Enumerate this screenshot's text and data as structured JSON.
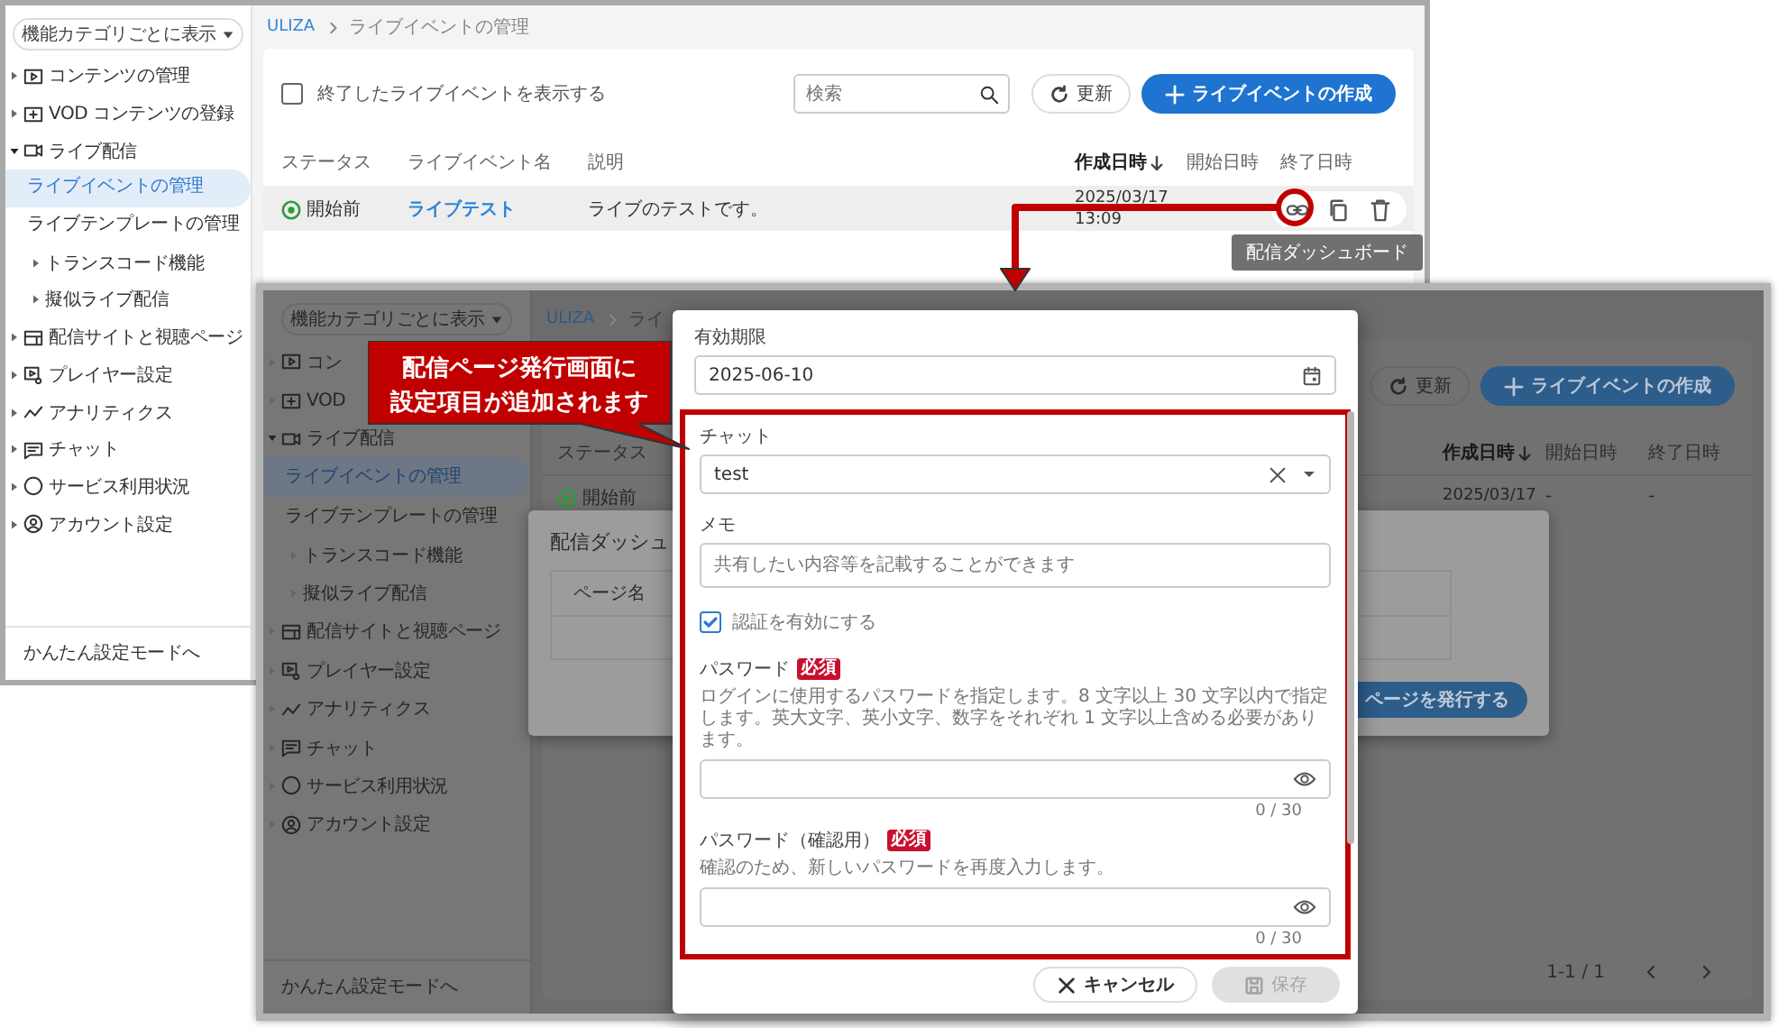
{
  "back_window": {
    "sidebar": {
      "view_selector": "機能カテゴリごとに表示",
      "items": [
        {
          "label": "コンテンツの管理",
          "expanded": false
        },
        {
          "label": "VOD コンテンツの登録",
          "expanded": false
        },
        {
          "label": "ライブ配信",
          "expanded": true,
          "children": [
            {
              "kind": "page",
              "label": "ライブイベントの管理",
              "selected": true
            },
            {
              "kind": "page",
              "label": "ライブテンプレートの管理",
              "selected": false
            },
            {
              "kind": "group",
              "label": "トランスコード機能",
              "expanded": false
            },
            {
              "kind": "group",
              "label": "擬似ライブ配信",
              "expanded": false
            }
          ]
        },
        {
          "label": "配信サイトと視聴ページ",
          "expanded": false
        },
        {
          "label": "プレイヤー設定",
          "expanded": false
        },
        {
          "label": "アナリティクス",
          "expanded": false
        },
        {
          "label": "チャット",
          "expanded": false
        },
        {
          "label": "サービス利用状況",
          "expanded": false
        },
        {
          "label": "アカウント設定",
          "expanded": false
        }
      ],
      "footer": "かんたん設定モードへ"
    },
    "main": {
      "breadcrumb": [
        "ULIZA",
        "ライブイベントの管理"
      ],
      "show_finished": {
        "label": "終了したライブイベントを表示する",
        "checked": false
      },
      "search": {
        "placeholder": "検索"
      },
      "refresh_button": "更新",
      "create_button": "ライブイベントの作成",
      "columns": [
        {
          "label": "ステータス",
          "sorted": false
        },
        {
          "label": "ライブイベント名",
          "sorted": false
        },
        {
          "label": "説明",
          "sorted": false
        },
        {
          "label": "作成日時",
          "sorted": true
        },
        {
          "label": "開始日時",
          "sorted": false
        },
        {
          "label": "終了日時",
          "sorted": false
        }
      ],
      "rows": [
        {
          "status": "開始前",
          "name": "ライブテスト",
          "description": "ライブのテストです。",
          "created": "2025/03/17 13:09"
        }
      ],
      "tooltip": "配信ダッシュボード"
    }
  },
  "front_window": {
    "sidebar": {
      "view_selector": "機能カテゴリごとに表示",
      "items": [
        {
          "label": "コン",
          "expanded": false
        },
        {
          "label": "VOD",
          "expanded": false
        },
        {
          "label": "ライブ配信",
          "expanded": true,
          "children": [
            {
              "kind": "page",
              "label": "ライブイベントの管理",
              "selected": true
            },
            {
              "kind": "page",
              "label": "ライブテンプレートの管理",
              "selected": false
            },
            {
              "kind": "group",
              "label": "トランスコード機能",
              "expanded": false
            },
            {
              "kind": "group",
              "label": "擬似ライブ配信",
              "expanded": false
            }
          ]
        },
        {
          "label": "配信サイトと視聴ページ",
          "expanded": false
        },
        {
          "label": "プレイヤー設定",
          "expanded": false
        },
        {
          "label": "アナリティクス",
          "expanded": false
        },
        {
          "label": "チャット",
          "expanded": false
        },
        {
          "label": "サービス利用状況",
          "expanded": false
        },
        {
          "label": "アカウント設定",
          "expanded": false
        }
      ],
      "footer": "かんたん設定モードへ"
    },
    "main": {
      "breadcrumb": [
        "ULIZA",
        "ライ"
      ],
      "refresh_button": "更新",
      "create_button": "ライブイベントの作成",
      "columns": [
        {
          "label": "ステータス",
          "sorted": false
        },
        {
          "label": "作成日時",
          "sorted": true
        },
        {
          "label": "開始日時",
          "sorted": false
        },
        {
          "label": "終了日時",
          "sorted": false
        }
      ],
      "rows": [
        {
          "status": "開始前",
          "created": "2025/03/17",
          "start": "-",
          "end": "-"
        }
      ],
      "pagination": "1-1 / 1"
    }
  },
  "dashboard_dialog": {
    "title": "配信ダッシュ",
    "column": "ページ名",
    "publish_button": "ページを発行する"
  },
  "form_dialog": {
    "expiry": {
      "label": "有効期限",
      "value": "2025-06-10"
    },
    "chat": {
      "label": "チャット",
      "value": "test"
    },
    "memo": {
      "label": "メモ",
      "placeholder": "共有したい内容等を記載することができます"
    },
    "auth": {
      "label": "認証を有効にする",
      "checked": true
    },
    "password_fields": [
      {
        "label": "パスワード",
        "badge": "必須",
        "help": "ログインに使用するパスワードを指定します。8 文字以上 30 文字以内で指定します。英大文字、英小文字、数字をそれぞれ 1 文字以上含める必要があります。",
        "counter": "0 / 30"
      },
      {
        "label": "パスワード（確認用）",
        "badge": "必須",
        "help": "確認のため、新しいパスワードを再度入力します。",
        "counter": "0 / 30"
      }
    ],
    "cancel_button": "キャンセル",
    "save_button": {
      "label": "保存",
      "disabled": true
    }
  },
  "callout": [
    "配信ページ発行画面に",
    "設定項目が追加されます"
  ]
}
